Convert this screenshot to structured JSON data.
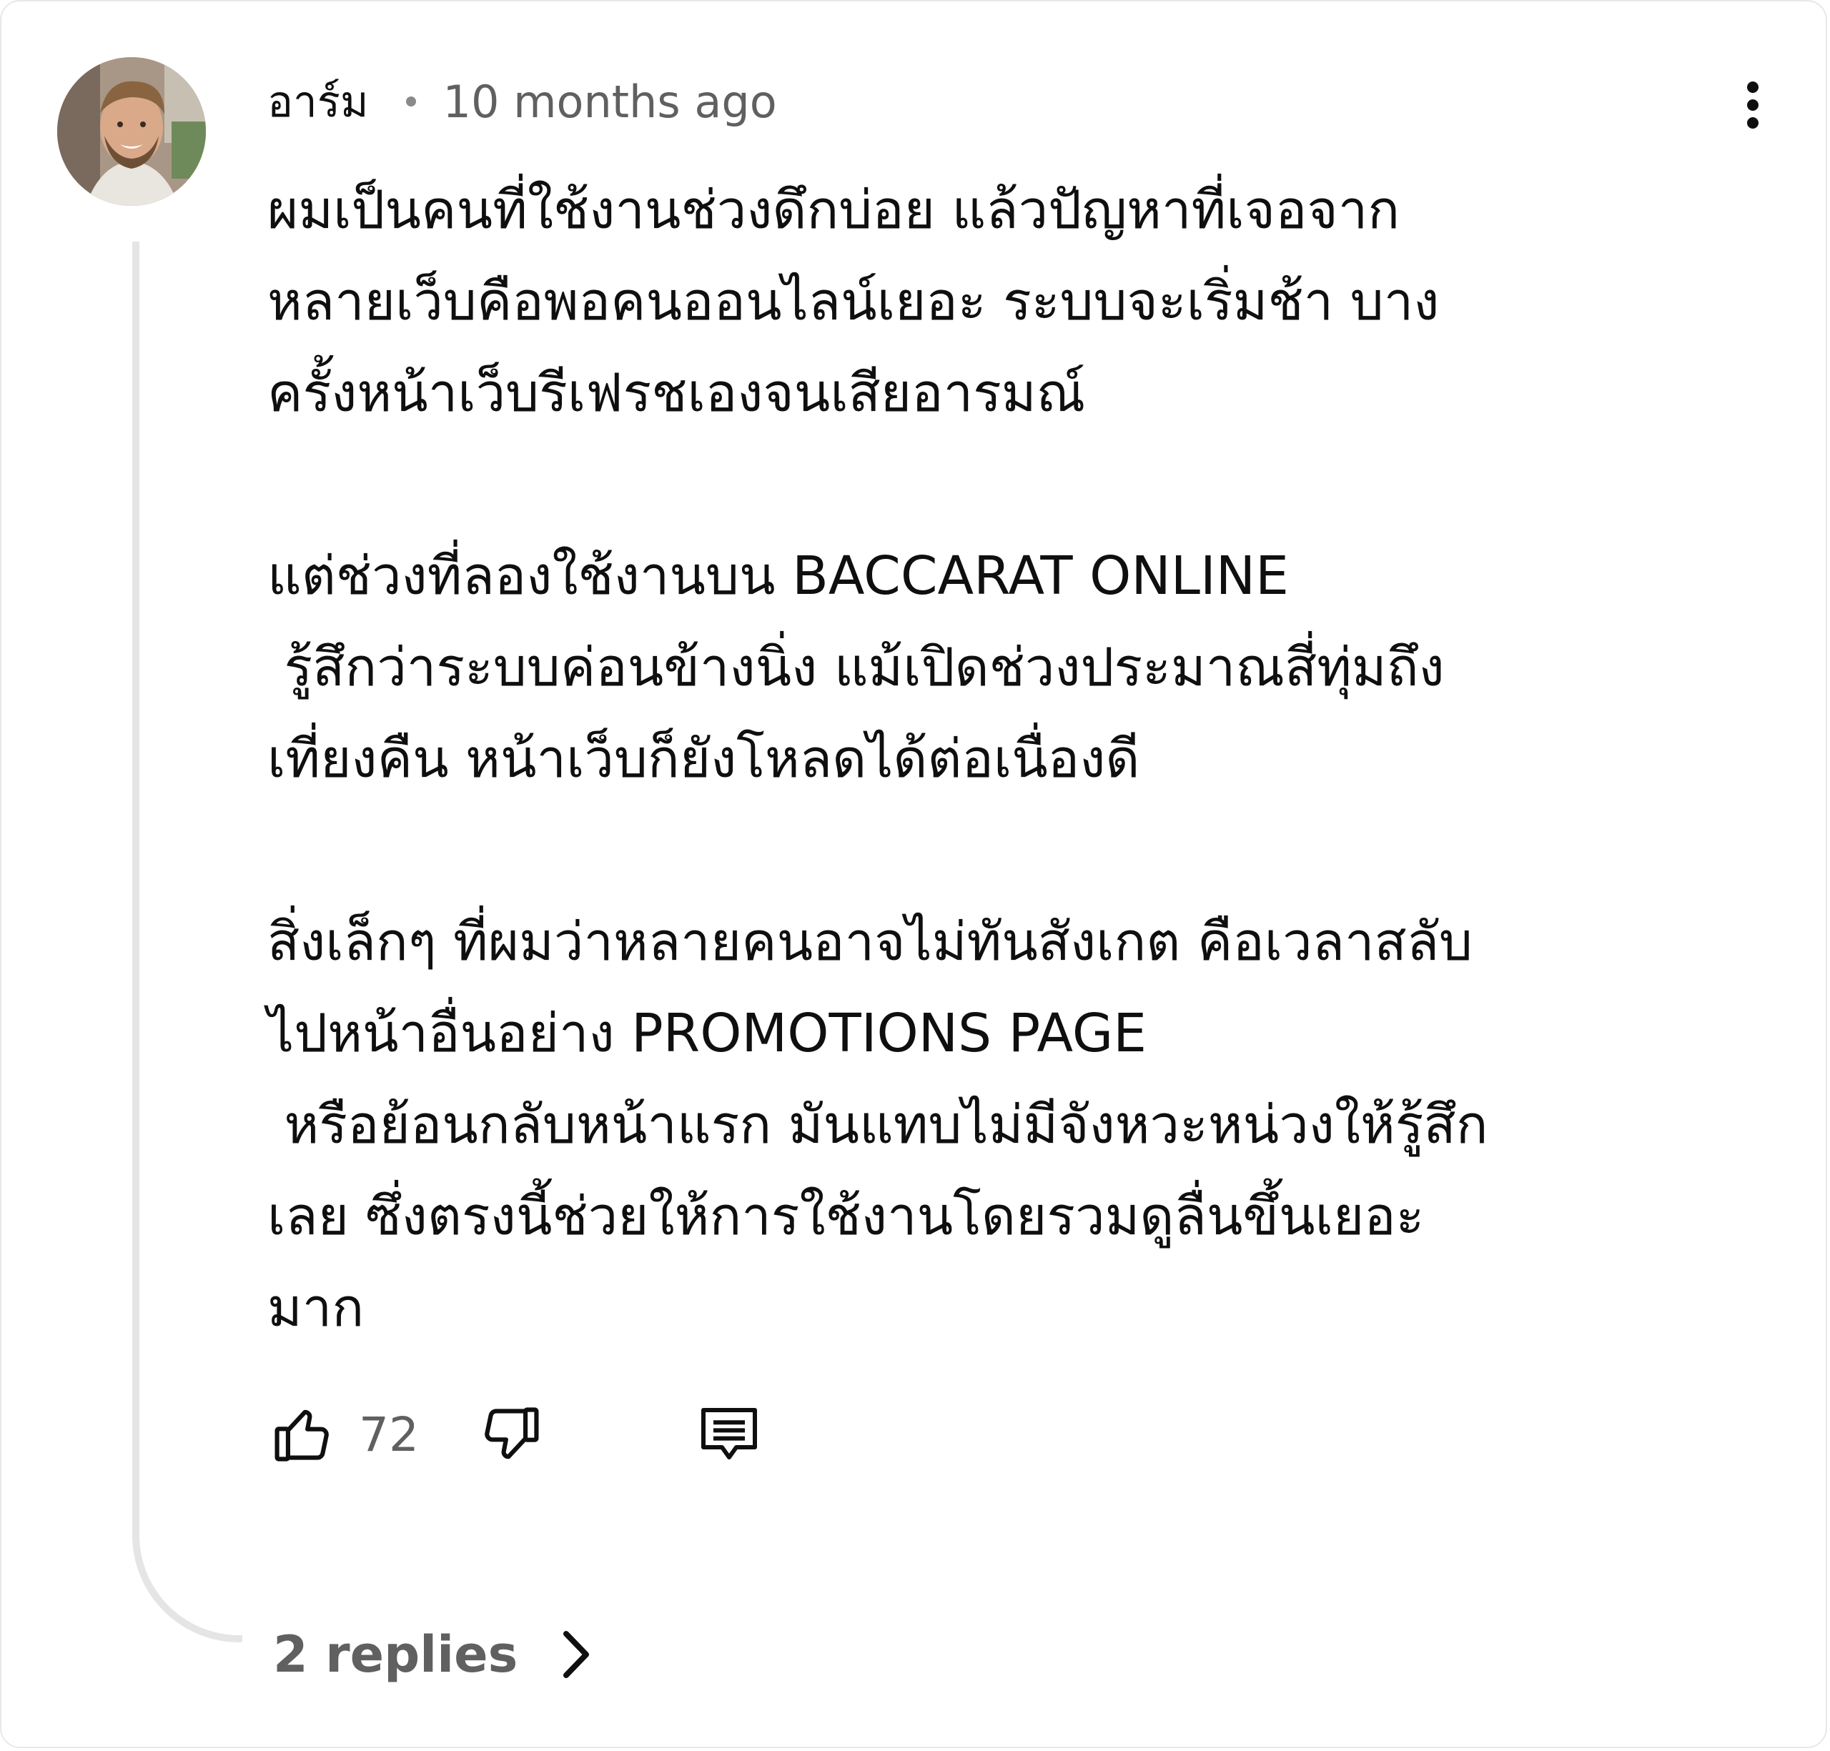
{
  "comment": {
    "author": "อาร์ม",
    "timestamp": "10 months ago",
    "avatar_icon": "user-avatar-photo",
    "more_icon": "more-vertical-icon",
    "lines": [
      "ผมเป็นคนที่ใช้งานช่วงดึกบ่อย แล้วปัญหาที่เจอจาก",
      "หลายเว็บคือพอคนออนไลน์เยอะ ระบบจะเริ่มช้า บาง",
      "ครั้งหน้าเว็บรีเฟรชเองจนเสียอารมณ์",
      "",
      "แต่ช่วงที่ลองใช้งานบน BACCARAT ONLINE",
      " รู้สึกว่าระบบค่อนข้างนิ่ง แม้เปิดช่วงประมาณสี่ทุ่มถึง",
      "เที่ยงคืน หน้าเว็บก็ยังโหลดได้ต่อเนื่องดี",
      "",
      "สิ่งเล็กๆ ที่ผมว่าหลายคนอาจไม่ทันสังเกต คือเวลาสลับ",
      "ไปหน้าอื่นอย่าง PROMOTIONS PAGE",
      " หรือย้อนกลับหน้าแรก มันแทบไม่มีจังหวะหน่วงให้รู้สึก",
      "เลย ซึ่งตรงนี้ช่วยให้การใช้งานโดยรวมดูลื่นขึ้นเยอะ",
      "มาก"
    ],
    "actions": {
      "like_icon": "thumbs-up-icon",
      "like_count": "72",
      "dislike_icon": "thumbs-down-icon",
      "reply_icon": "comment-reply-icon"
    },
    "replies": {
      "label": "2 replies",
      "icon": "chevron-right-icon"
    }
  },
  "colors": {
    "text_primary": "#0f0f0f",
    "text_secondary": "#606060",
    "thread_line": "#e5e5e5",
    "border": "#e8e8e8"
  }
}
